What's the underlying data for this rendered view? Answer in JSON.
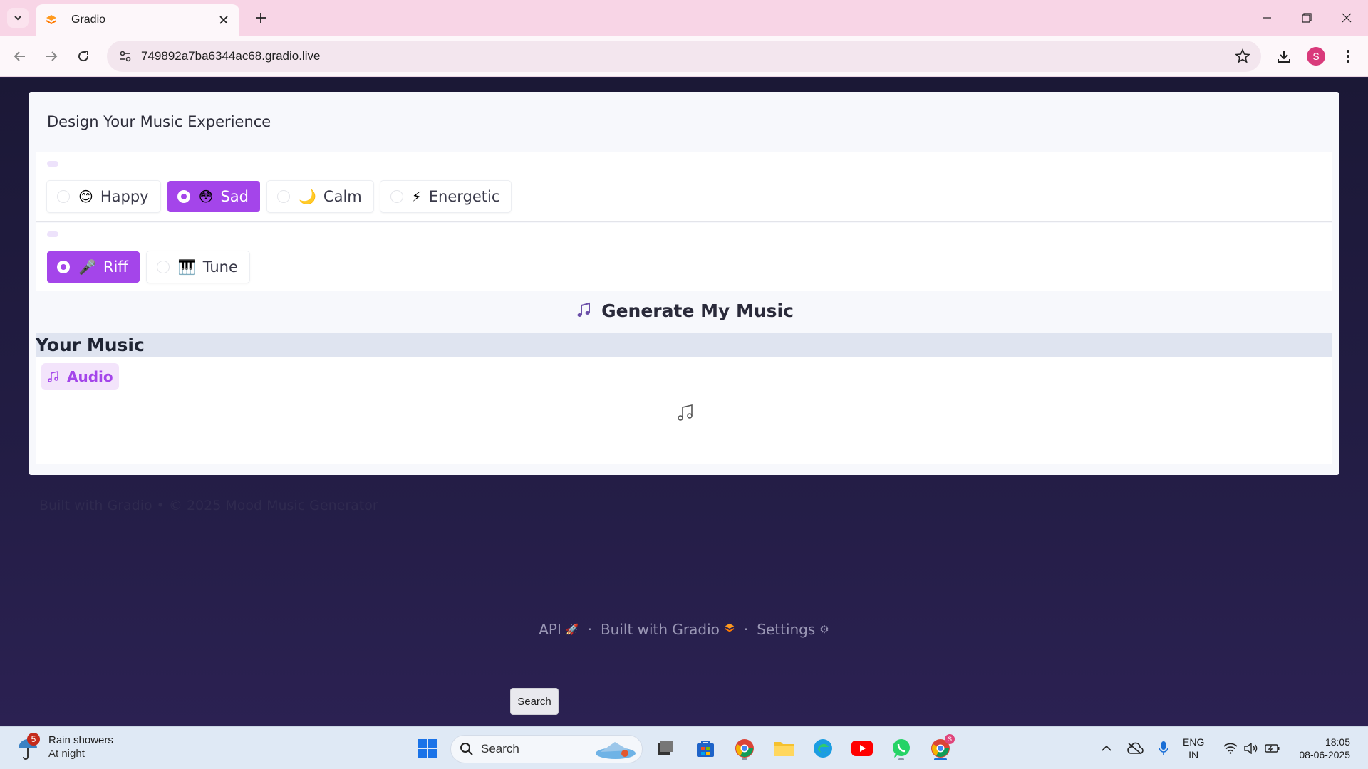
{
  "browser": {
    "tab_title": "Gradio",
    "url": "749892a7ba6344ac68.gradio.live",
    "profile_initial": "S"
  },
  "app": {
    "title": "Design Your Music Experience",
    "moods": [
      {
        "emoji": "😊",
        "label": "Happy",
        "selected": false
      },
      {
        "emoji": "😳",
        "label": "Sad",
        "selected": true
      },
      {
        "emoji": "🌙",
        "label": "Calm",
        "selected": false
      },
      {
        "emoji": "⚡",
        "label": "Energetic",
        "selected": false
      }
    ],
    "styles": [
      {
        "emoji": "🎤",
        "label": "Riff",
        "selected": true
      },
      {
        "emoji": "🎹",
        "label": "Tune",
        "selected": false
      }
    ],
    "generate_label": "Generate My Music",
    "output_heading": "Your Music",
    "audio_label": "Audio",
    "page_footer": "Built with Gradio • © 2025 Mood Music Generator"
  },
  "gradio_footer": {
    "api_label": "API",
    "built_label": "Built with Gradio",
    "settings_label": "Settings",
    "tooltip": "Search"
  },
  "taskbar": {
    "weather_badge": "5",
    "weather_line1": "Rain showers",
    "weather_line2": "At night",
    "search_label": "Search",
    "lang_line1": "ENG",
    "lang_line2": "IN",
    "time": "18:05",
    "date": "08-06-2025",
    "chrome_badge": "S"
  },
  "colors": {
    "accent": "#a445ea",
    "tab_strip": "#f8d5e6",
    "page_bg": "#241d44"
  }
}
